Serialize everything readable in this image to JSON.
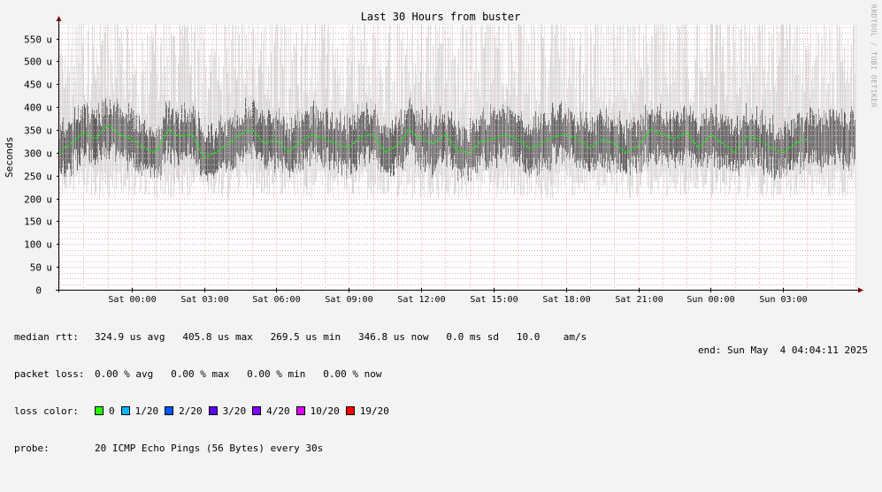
{
  "colors": {
    "background": "#f3f3f3",
    "plot_background": "#ffffff",
    "grid": "#e8b0b0",
    "median_line": "#00ff00",
    "axis": "#000000",
    "arrow": "#800000"
  },
  "side_text": "RRDTOOL / TOBI OETIKER",
  "chart_data": {
    "type": "line",
    "title": "Last 30 Hours from buster",
    "ylabel": "Seconds",
    "xlabel": "",
    "y_unit_suffix": "u",
    "ylim": [
      0,
      580
    ],
    "y_ticks": [
      0,
      50,
      100,
      150,
      200,
      250,
      300,
      350,
      400,
      450,
      500,
      550
    ],
    "y_tick_labels": [
      "0",
      "50 u",
      "100 u",
      "150 u",
      "200 u",
      "250 u",
      "300 u",
      "350 u",
      "400 u",
      "450 u",
      "500 u",
      "550 u"
    ],
    "x_unit": "hours",
    "xlim": [
      -3.0,
      30.0
    ],
    "x_ticks": [
      0,
      3,
      6,
      9,
      12,
      15,
      18,
      21,
      24,
      27
    ],
    "x_tick_labels": [
      "Sat 00:00",
      "Sat 03:00",
      "Sat 06:00",
      "Sat 09:00",
      "Sat 12:00",
      "Sat 15:00",
      "Sat 18:00",
      "Sat 21:00",
      "Sun 00:00",
      "Sun 03:00"
    ],
    "x_minor_step": 1,
    "grid": true,
    "smoke_range": {
      "min": 200,
      "max": 580
    },
    "series": [
      {
        "name": "median rtt",
        "color": "#00ff00",
        "x": [
          -3.0,
          -2.5,
          -2.0,
          -1.5,
          -1.0,
          -0.5,
          0.0,
          0.5,
          1.0,
          1.5,
          2.0,
          2.5,
          3.0,
          3.5,
          4.0,
          4.5,
          5.0,
          5.5,
          6.0,
          6.5,
          7.0,
          7.5,
          8.0,
          8.5,
          9.0,
          9.5,
          10.0,
          10.5,
          11.0,
          11.5,
          12.0,
          12.5,
          13.0,
          13.5,
          14.0,
          14.5,
          15.0,
          15.5,
          16.0,
          16.5,
          17.0,
          17.5,
          18.0,
          18.5,
          19.0,
          19.5,
          20.0,
          20.5,
          21.0,
          21.5,
          22.0,
          22.5,
          23.0,
          23.5,
          24.0,
          24.5,
          25.0,
          25.5,
          26.0,
          26.5,
          27.0,
          27.5,
          28.0
        ],
        "values": [
          300,
          320,
          345,
          330,
          360,
          340,
          330,
          310,
          300,
          350,
          335,
          340,
          290,
          300,
          320,
          340,
          350,
          320,
          330,
          300,
          325,
          340,
          330,
          320,
          310,
          335,
          340,
          300,
          315,
          350,
          330,
          320,
          340,
          305,
          300,
          325,
          330,
          340,
          330,
          310,
          320,
          335,
          340,
          330,
          310,
          330,
          320,
          300,
          315,
          350,
          340,
          330,
          345,
          310,
          340,
          320,
          300,
          335,
          330,
          310,
          300,
          320,
          330
        ]
      }
    ]
  },
  "legend": {
    "median_label": "median rtt:",
    "median_values": "324.9 us avg   405.8 us max   269.5 us min   346.8 us now   0.0 ms sd   10.0    am/s",
    "loss_label": "packet loss:",
    "loss_values": "0.00 % avg   0.00 % max   0.00 % min   0.00 % now",
    "color_label": "loss color:",
    "loss_colors": [
      {
        "label": "0",
        "color": "#26ff00"
      },
      {
        "label": "1/20",
        "color": "#00b8ff"
      },
      {
        "label": "2/20",
        "color": "#0059ff"
      },
      {
        "label": "3/20",
        "color": "#5e00ff"
      },
      {
        "label": "4/20",
        "color": "#7e00ff"
      },
      {
        "label": "10/20",
        "color": "#dd00ff"
      },
      {
        "label": "19/20",
        "color": "#ff0000"
      }
    ],
    "probe_label": "probe:",
    "probe_value": "20 ICMP Echo Pings (56 Bytes) every 30s",
    "end_text": "end: Sun May  4 04:04:11 2025"
  }
}
